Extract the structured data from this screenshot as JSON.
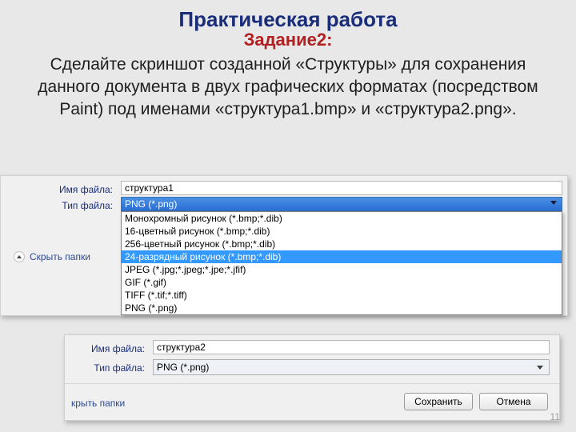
{
  "title": "Практическая работа",
  "task": "Задание2:",
  "instruction": "Сделайте скриншот созданной «Структуры» для сохранения данного документа в двух графических форматах (посредством Paint) под именами «структура1.bmp» и «структура2.png».",
  "labels": {
    "filename": "Имя файла:",
    "filetype": "Тип файла:",
    "hide_folders": "Скрыть папки",
    "hide_folders_partial": "крыть папки"
  },
  "dialog1": {
    "filename_value": "структура1",
    "filetype_selected": "PNG (*.png)",
    "options": [
      "Монохромный рисунок (*.bmp;*.dib)",
      "16-цветный рисунок (*.bmp;*.dib)",
      "256-цветный рисунок (*.bmp;*.dib)",
      "24-разрядный рисунок (*.bmp;*.dib)",
      "JPEG (*.jpg;*.jpeg;*.jpe;*.jfif)",
      "GIF (*.gif)",
      "TIFF (*.tif;*.tiff)",
      "PNG (*.png)"
    ],
    "highlight_index": 3
  },
  "dialog2": {
    "filename_value": "структура2",
    "filetype_selected": "PNG (*.png)"
  },
  "buttons": {
    "save": "Сохранить",
    "cancel": "Отмена"
  },
  "page_number": "11"
}
